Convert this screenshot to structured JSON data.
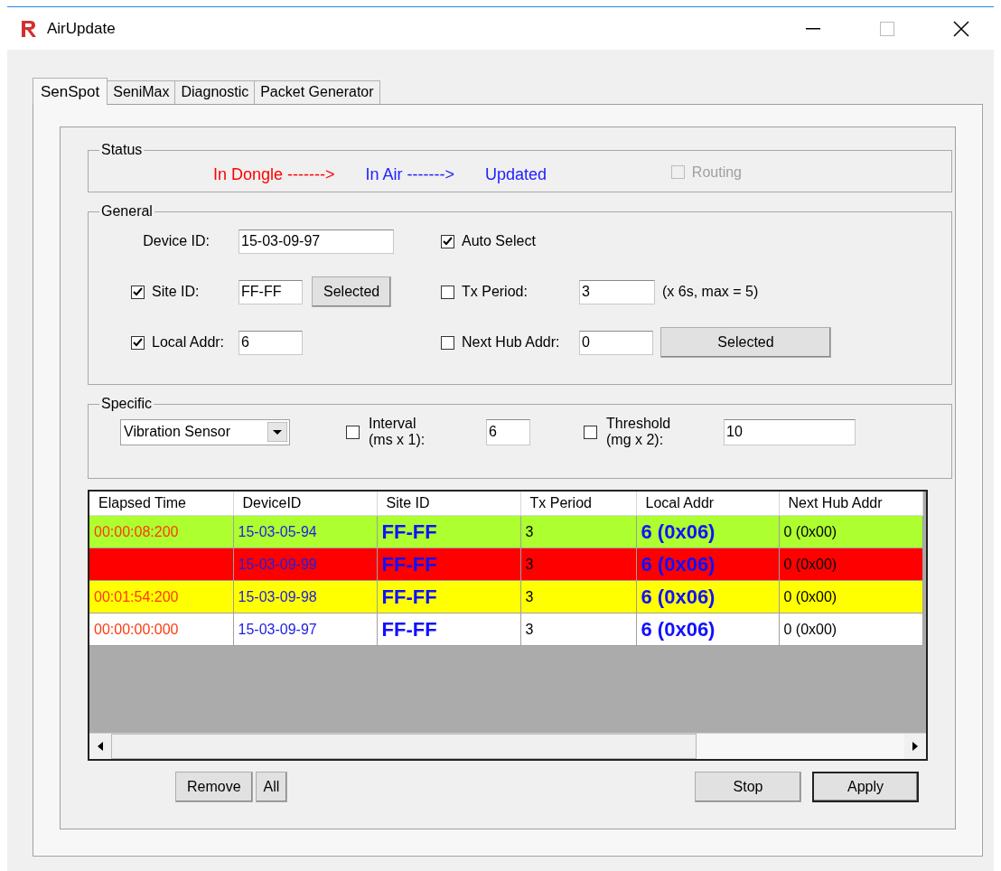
{
  "window": {
    "title": "AirUpdate"
  },
  "tabs": [
    {
      "label": "SenSpot",
      "selected": true
    },
    {
      "label": "SeniMax",
      "selected": false
    },
    {
      "label": "Diagnostic",
      "selected": false
    },
    {
      "label": "Packet Generator",
      "selected": false
    }
  ],
  "status": {
    "title": "Status",
    "stages": [
      {
        "text": "In Dongle ------->",
        "color": "#ff0000"
      },
      {
        "text": "In Air ------->",
        "color": "#2020ff"
      },
      {
        "text": "Updated",
        "color": "#2020ff"
      }
    ],
    "routing": {
      "label": "Routing",
      "checked": false,
      "disabled": true
    }
  },
  "general": {
    "title": "General",
    "device_id": {
      "label": "Device ID:",
      "value": "15-03-09-97"
    },
    "auto_select": {
      "label": "Auto Select",
      "checked": true
    },
    "site_id": {
      "label": "Site ID:",
      "checked": true,
      "value": "FF-FF",
      "button": "Selected"
    },
    "tx_period": {
      "label": "Tx Period:",
      "checked": false,
      "value": "3",
      "hint": "(x 6s, max = 5)"
    },
    "local_addr": {
      "label": "Local Addr:",
      "checked": true,
      "value": "6"
    },
    "next_hub_addr": {
      "label": "Next Hub Addr:",
      "checked": false,
      "value": "0",
      "button": "Selected"
    }
  },
  "specific": {
    "title": "Specific",
    "sensor_type": "Vibration Sensor",
    "interval": {
      "label_lines": [
        "Interval",
        "(ms x 1):"
      ],
      "checked": false,
      "value": "6"
    },
    "threshold": {
      "label_lines": [
        "Threshold",
        "(mg x 2):"
      ],
      "checked": false,
      "value": "10"
    }
  },
  "table": {
    "columns": [
      "Elapsed Time",
      "DeviceID",
      "Site ID",
      "Tx Period",
      "Local Addr",
      "Next Hub Addr"
    ],
    "rows": [
      {
        "color": "#adff2f",
        "cells": [
          "00:00:08:200",
          "15-03-05-94",
          "FF-FF",
          "3",
          "6 (0x06)",
          "0 (0x00)"
        ]
      },
      {
        "color": "#ff0000",
        "cells": [
          "",
          "15-03-09-99",
          "FF-FF",
          "3",
          "6 (0x06)",
          "0 (0x00)"
        ]
      },
      {
        "color": "#ffff00",
        "cells": [
          "00:01:54:200",
          "15-03-09-98",
          "FF-FF",
          "3",
          "6 (0x06)",
          "0 (0x00)"
        ]
      },
      {
        "color": "#ffffff",
        "cells": [
          "00:00:00:000",
          "15-03-09-97",
          "FF-FF",
          "3",
          "6 (0x06)",
          "0 (0x00)"
        ]
      }
    ]
  },
  "left_buttons": [
    {
      "label": "Remove",
      "default": false
    },
    {
      "label": "All",
      "default": false
    }
  ],
  "right_buttons": [
    {
      "label": "Stop",
      "default": false
    },
    {
      "label": "Apply",
      "default": true
    }
  ]
}
